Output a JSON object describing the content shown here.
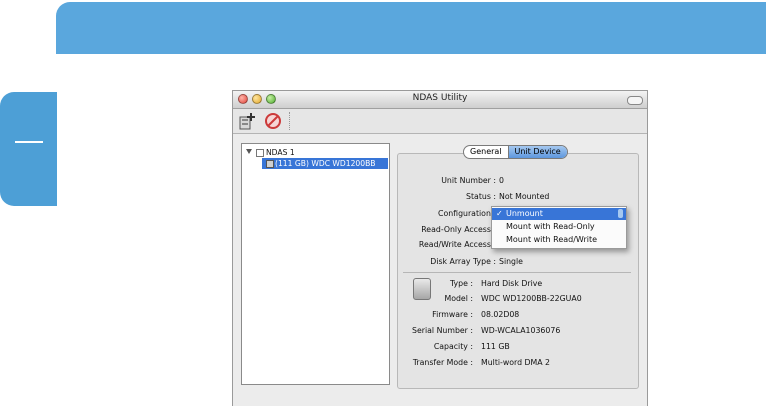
{
  "window": {
    "title": "NDAS Utility"
  },
  "toolbar": {
    "register_icon": "register-device-icon",
    "unregister_icon": "unregister-device-icon"
  },
  "tree": {
    "items": [
      {
        "label": "NDAS 1",
        "expanded": true,
        "checked": false
      },
      {
        "label": "(111 GB) WDC WD1200BB",
        "selected": true
      }
    ]
  },
  "tabs": [
    {
      "label": "General",
      "active": false
    },
    {
      "label": "Unit Device",
      "active": true
    }
  ],
  "unit_info": {
    "unit_number_label": "Unit Number :",
    "unit_number": "0",
    "status_label": "Status :",
    "status": "Not Mounted",
    "configuration_label": "Configuration :",
    "read_only_access_label": "Read-Only Access :",
    "read_write_access_label": "Read/Write Access :",
    "disk_array_type_label": "Disk Array Type :",
    "disk_array_type": "Single"
  },
  "configuration_menu": {
    "selected": "Unmount",
    "checkmark": "✓",
    "options": [
      "Unmount",
      "Mount with Read-Only",
      "Mount with Read/Write"
    ]
  },
  "drive_info": {
    "icon": "hard-disk-icon",
    "type_label": "Type :",
    "type": "Hard Disk Drive",
    "model_label": "Model :",
    "model": "WDC WD1200BB-22GUA0",
    "firmware_label": "Firmware :",
    "firmware": "08.02D08",
    "serial_label": "Serial Number :",
    "serial": "WD-WCALA1036076",
    "capacity_label": "Capacity :",
    "capacity": "111 GB",
    "transfer_mode_label": "Transfer Mode :",
    "transfer_mode": "Multi-word DMA 2"
  },
  "colors": {
    "banner": "#5aa7dd",
    "side_tab": "#4d9fd6",
    "selection": "#3875d7"
  }
}
